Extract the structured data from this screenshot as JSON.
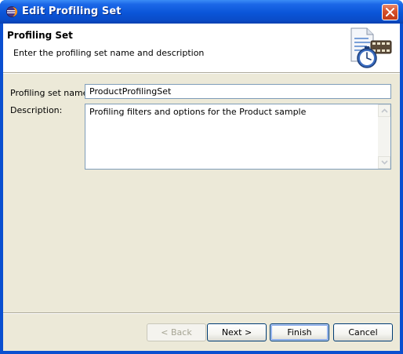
{
  "window": {
    "title": "Edit Profiling Set"
  },
  "header": {
    "title": "Profiling Set",
    "description": "Enter the profiling set name and description"
  },
  "form": {
    "name_label": "Profiling set name:",
    "name_value": "ProductProfilingSet",
    "description_label": "Description:",
    "description_value": "Profiling filters and options for the Product sample"
  },
  "buttons": {
    "back": "< Back",
    "next": "Next >",
    "finish": "Finish",
    "cancel": "Cancel"
  },
  "icons": {
    "app": "eclipse-icon",
    "close": "close-icon",
    "wizard": "profiling-stopwatch-icon"
  },
  "colors": {
    "titlebar": "#0a55d8",
    "dialog_background": "#ece9d8",
    "close_button": "#d6502a",
    "input_border": "#7f9db9"
  }
}
